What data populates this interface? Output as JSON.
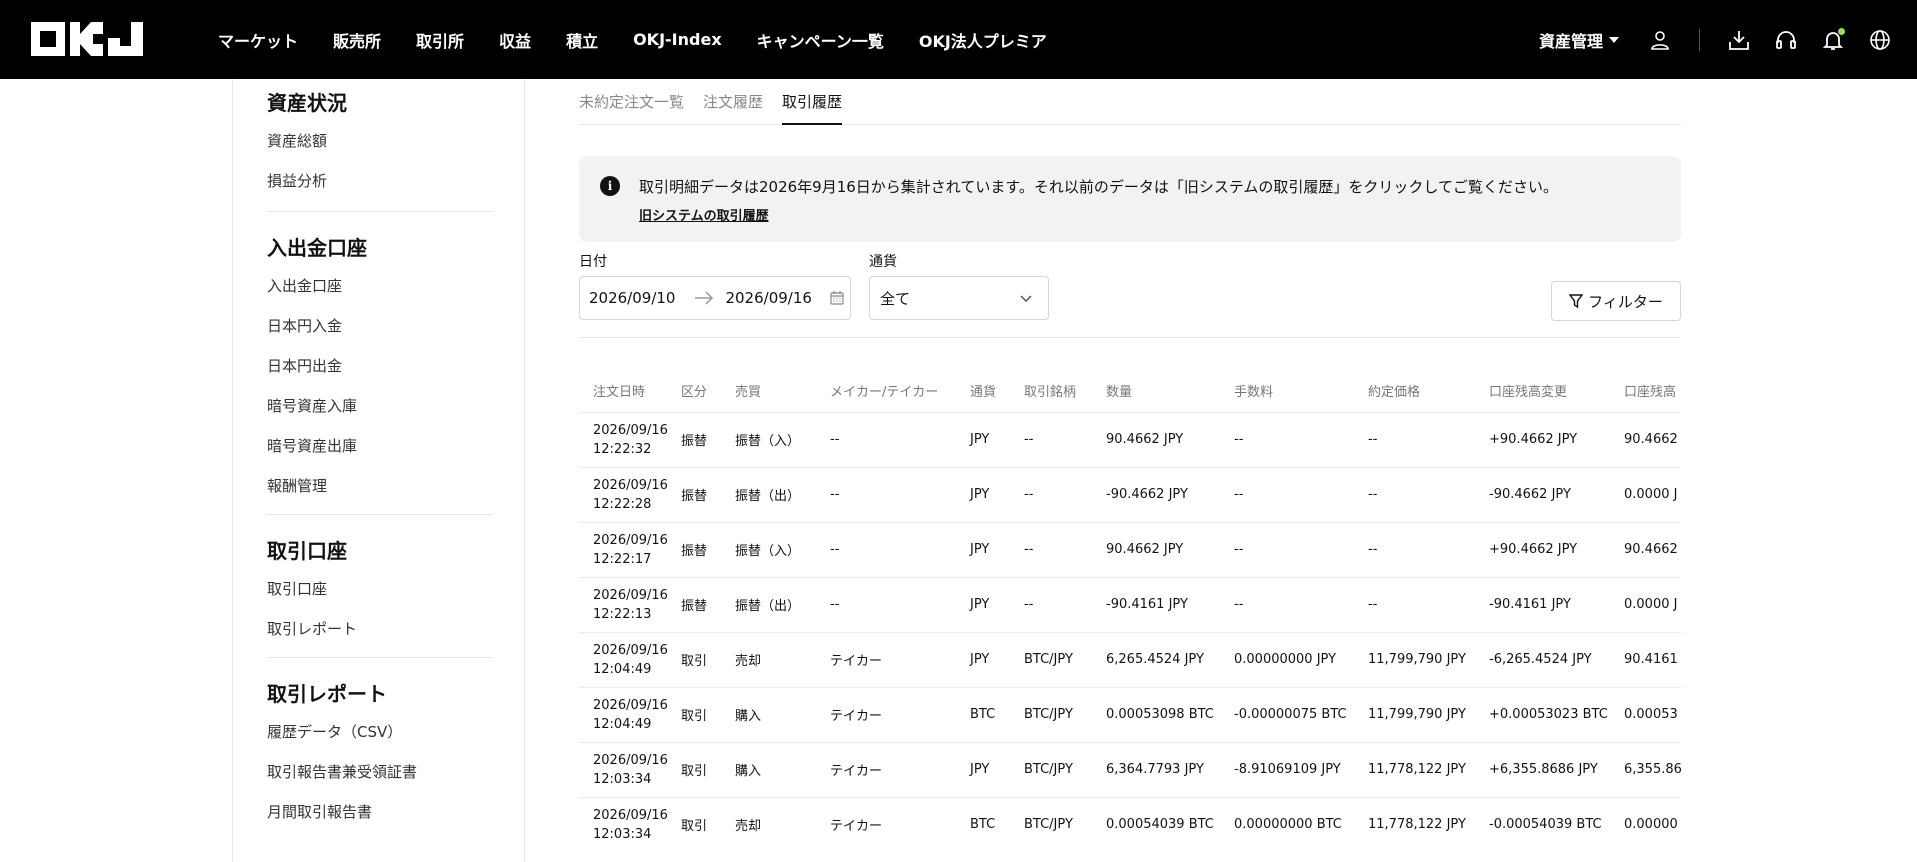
{
  "header": {
    "brand": "OKJ",
    "nav": [
      "マーケット",
      "販売所",
      "取引所",
      "収益",
      "積立",
      "OKJ-Index",
      "キャンペーン一覧",
      "OKJ法人プレミア"
    ],
    "asset_menu": "資産管理",
    "icons": [
      "user-icon",
      "download-icon",
      "headset-icon",
      "bell-icon",
      "globe-icon"
    ]
  },
  "sidebar": {
    "groups": [
      {
        "title": "資産状況",
        "items": [
          "資産総額",
          "損益分析"
        ]
      },
      {
        "title": "入出金口座",
        "items": [
          "入出金口座",
          "日本円入金",
          "日本円出金",
          "暗号資産入庫",
          "暗号資産出庫",
          "報酬管理"
        ]
      },
      {
        "title": "取引口座",
        "items": [
          "取引口座",
          "取引レポート"
        ]
      },
      {
        "title": "取引レポート",
        "items": [
          "履歴データ（CSV）",
          "取引報告書兼受領証書",
          "月間取引報告書"
        ]
      }
    ]
  },
  "main": {
    "tabs": [
      "未約定注文一覧",
      "注文履歴",
      "取引履歴"
    ],
    "active_tab": 2,
    "notice": {
      "text": "取引明細データは2026年9月16日から集計されています。それ以前のデータは「旧システムの取引履歴」をクリックしてご覧ください。",
      "link": "旧システムの取引履歴"
    },
    "filters": {
      "date_label": "日付",
      "date_from": "2026/09/10",
      "date_to": "2026/09/16",
      "currency_label": "通貨",
      "currency_value": "全て",
      "filter_button": "フィルター"
    },
    "table": {
      "columns": [
        "注文日時",
        "区分",
        "売買",
        "メイカー/テイカー",
        "通貨",
        "取引銘柄",
        "数量",
        "手数料",
        "約定価格",
        "口座残高変更",
        "口座残高"
      ],
      "rows": [
        [
          "2026/09/16",
          "12:22:32",
          "振替",
          "振替（入）",
          "--",
          "JPY",
          "--",
          "90.4662 JPY",
          "--",
          "--",
          "+90.4662 JPY",
          "90.4662"
        ],
        [
          "2026/09/16",
          "12:22:28",
          "振替",
          "振替（出）",
          "--",
          "JPY",
          "--",
          "-90.4662 JPY",
          "--",
          "--",
          "-90.4662 JPY",
          "0.0000 J"
        ],
        [
          "2026/09/16",
          "12:22:17",
          "振替",
          "振替（入）",
          "--",
          "JPY",
          "--",
          "90.4662 JPY",
          "--",
          "--",
          "+90.4662 JPY",
          "90.4662"
        ],
        [
          "2026/09/16",
          "12:22:13",
          "振替",
          "振替（出）",
          "--",
          "JPY",
          "--",
          "-90.4161 JPY",
          "--",
          "--",
          "-90.4161 JPY",
          "0.0000 J"
        ],
        [
          "2026/09/16",
          "12:04:49",
          "取引",
          "売却",
          "テイカー",
          "JPY",
          "BTC/JPY",
          "6,265.4524 JPY",
          "0.00000000 JPY",
          "11,799,790 JPY",
          "-6,265.4524 JPY",
          "90.4161"
        ],
        [
          "2026/09/16",
          "12:04:49",
          "取引",
          "購入",
          "テイカー",
          "BTC",
          "BTC/JPY",
          "0.00053098 BTC",
          "-0.00000075 BTC",
          "11,799,790 JPY",
          "+0.00053023 BTC",
          "0.00053"
        ],
        [
          "2026/09/16",
          "12:03:34",
          "取引",
          "購入",
          "テイカー",
          "JPY",
          "BTC/JPY",
          "6,364.7793 JPY",
          "-8.91069109 JPY",
          "11,778,122 JPY",
          "+6,355.8686 JPY",
          "6,355.86"
        ],
        [
          "2026/09/16",
          "12:03:34",
          "取引",
          "売却",
          "テイカー",
          "BTC",
          "BTC/JPY",
          "0.00054039 BTC",
          "0.00000000 BTC",
          "11,778,122 JPY",
          "-0.00054039 BTC",
          "0.00000"
        ]
      ]
    }
  }
}
